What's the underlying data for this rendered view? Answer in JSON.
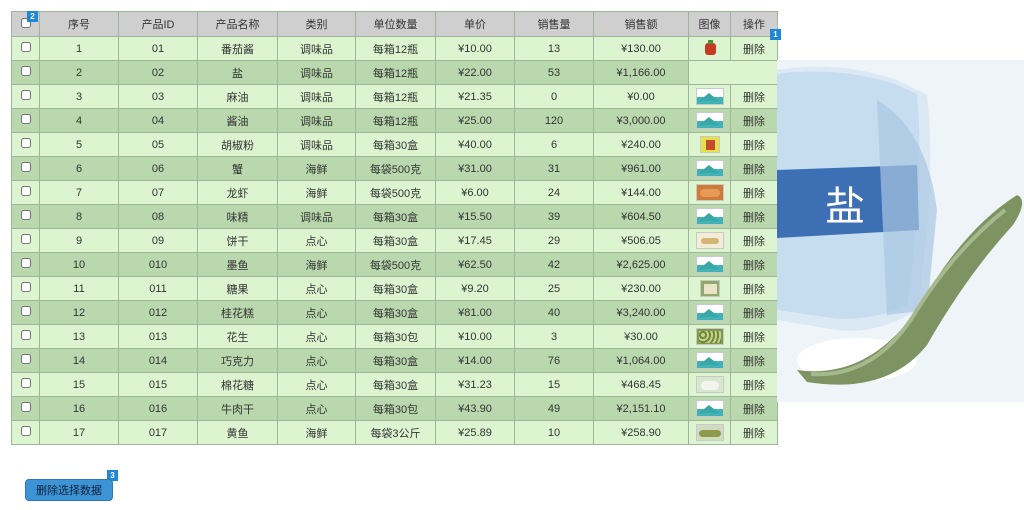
{
  "table": {
    "columns": [
      "序号",
      "产品ID",
      "产品名称",
      "类别",
      "单位数量",
      "单价",
      "销售量",
      "销售额",
      "图像",
      "操作"
    ],
    "rows": [
      {
        "seq": "1",
        "id": "01",
        "name": "番茄酱",
        "category": "调味品",
        "unit": "每箱12瓶",
        "price": "¥10.00",
        "qty": "13",
        "amount": "¥130.00",
        "image": "tomato-sauce-thumbnail",
        "action": "删除"
      },
      {
        "seq": "2",
        "id": "02",
        "name": "盐",
        "category": "调味品",
        "unit": "每箱12瓶",
        "price": "¥22.00",
        "qty": "53",
        "amount": "¥1,166.00",
        "image": "",
        "action": ""
      },
      {
        "seq": "3",
        "id": "03",
        "name": "麻油",
        "category": "调味品",
        "unit": "每箱12瓶",
        "price": "¥21.35",
        "qty": "0",
        "amount": "¥0.00",
        "image": "image-placeholder-thumbnail",
        "action": "删除"
      },
      {
        "seq": "4",
        "id": "04",
        "name": "酱油",
        "category": "调味品",
        "unit": "每箱12瓶",
        "price": "¥25.00",
        "qty": "120",
        "amount": "¥3,000.00",
        "image": "image-placeholder-thumbnail",
        "action": "删除"
      },
      {
        "seq": "5",
        "id": "05",
        "name": "胡椒粉",
        "category": "调味品",
        "unit": "每箱30盒",
        "price": "¥40.00",
        "qty": "6",
        "amount": "¥240.00",
        "image": "pepper-thumbnail",
        "action": "删除"
      },
      {
        "seq": "6",
        "id": "06",
        "name": "蟹",
        "category": "海鲜",
        "unit": "每袋500克",
        "price": "¥31.00",
        "qty": "31",
        "amount": "¥961.00",
        "image": "image-placeholder-thumbnail",
        "action": "删除"
      },
      {
        "seq": "7",
        "id": "07",
        "name": "龙虾",
        "category": "海鲜",
        "unit": "每袋500克",
        "price": "¥6.00",
        "qty": "24",
        "amount": "¥144.00",
        "image": "shrimp-thumbnail",
        "action": "删除"
      },
      {
        "seq": "8",
        "id": "08",
        "name": "味精",
        "category": "调味品",
        "unit": "每箱30盒",
        "price": "¥15.50",
        "qty": "39",
        "amount": "¥604.50",
        "image": "image-placeholder-thumbnail",
        "action": "删除"
      },
      {
        "seq": "9",
        "id": "09",
        "name": "饼干",
        "category": "点心",
        "unit": "每箱30盒",
        "price": "¥17.45",
        "qty": "29",
        "amount": "¥506.05",
        "image": "cookie-thumbnail",
        "action": "删除"
      },
      {
        "seq": "10",
        "id": "010",
        "name": "墨鱼",
        "category": "海鲜",
        "unit": "每袋500克",
        "price": "¥62.50",
        "qty": "42",
        "amount": "¥2,625.00",
        "image": "image-placeholder-thumbnail",
        "action": "删除"
      },
      {
        "seq": "11",
        "id": "011",
        "name": "糖果",
        "category": "点心",
        "unit": "每箱30盒",
        "price": "¥9.20",
        "qty": "25",
        "amount": "¥230.00",
        "image": "candy-thumbnail",
        "action": "删除"
      },
      {
        "seq": "12",
        "id": "012",
        "name": "桂花糕",
        "category": "点心",
        "unit": "每箱30盒",
        "price": "¥81.00",
        "qty": "40",
        "amount": "¥3,240.00",
        "image": "image-placeholder-thumbnail",
        "action": "删除"
      },
      {
        "seq": "13",
        "id": "013",
        "name": "花生",
        "category": "点心",
        "unit": "每箱30包",
        "price": "¥10.00",
        "qty": "3",
        "amount": "¥30.00",
        "image": "peanut-thumbnail",
        "action": "删除"
      },
      {
        "seq": "14",
        "id": "014",
        "name": "巧克力",
        "category": "点心",
        "unit": "每箱30盒",
        "price": "¥14.00",
        "qty": "76",
        "amount": "¥1,064.00",
        "image": "image-placeholder-thumbnail",
        "action": "删除"
      },
      {
        "seq": "15",
        "id": "015",
        "name": "棉花糖",
        "category": "点心",
        "unit": "每箱30盒",
        "price": "¥31.23",
        "qty": "15",
        "amount": "¥468.45",
        "image": "marshmallow-thumbnail",
        "action": "删除"
      },
      {
        "seq": "16",
        "id": "016",
        "name": "牛肉干",
        "category": "点心",
        "unit": "每箱30包",
        "price": "¥43.90",
        "qty": "49",
        "amount": "¥2,151.10",
        "image": "image-placeholder-thumbnail",
        "action": "删除"
      },
      {
        "seq": "17",
        "id": "017",
        "name": "黄鱼",
        "category": "海鲜",
        "unit": "每袋3公斤",
        "price": "¥25.89",
        "qty": "10",
        "amount": "¥258.90",
        "image": "fish-thumbnail",
        "action": "删除"
      }
    ]
  },
  "preview": {
    "image": "salt-bag-with-spoon-image",
    "label": "盐"
  },
  "badges": [
    "1",
    "2",
    "3"
  ],
  "delete_selected_button": "删除选择数据",
  "colors": {
    "row_odd": "#dcf5d0",
    "row_even": "#b9d8ad",
    "header": "#cfcfcf",
    "button": "#3c93d5",
    "badge": "#1e87d6"
  }
}
